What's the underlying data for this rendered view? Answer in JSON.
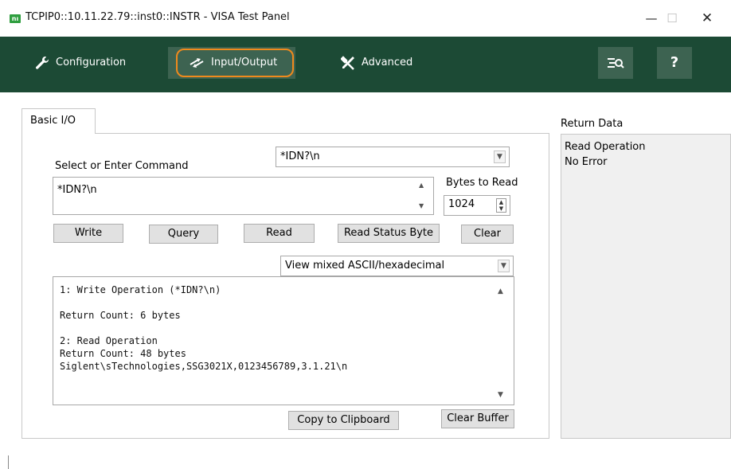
{
  "window": {
    "logo_text": "nı",
    "title": "TCPIP0::10.11.22.79::inst0::INSTR - VISA Test Panel",
    "minimize_glyph": "—",
    "maximize_glyph": "☐",
    "close_glyph": "✕"
  },
  "toolbar": {
    "configuration": "Configuration",
    "input_output": "Input/Output",
    "advanced": "Advanced",
    "help_glyph": "?",
    "accent_color": "#f08a1c",
    "bg_color": "#1c4a35",
    "active_bg_color": "#3d6351"
  },
  "tabs": [
    {
      "label": "Basic I/O",
      "selected": true
    }
  ],
  "basic_io": {
    "select_label": "Select or Enter Command",
    "command_combo_value": "*IDN?\\n",
    "command_text": "*IDN?\\n",
    "bytes_to_read_label": "Bytes to Read",
    "bytes_to_read_value": "1024",
    "buttons": {
      "write": "Write",
      "query": "Query",
      "read": "Read",
      "read_status_byte": "Read Status Byte",
      "clear": "Clear",
      "copy_to_clipboard": "Copy to Clipboard",
      "clear_buffer": "Clear Buffer"
    },
    "view_mode": "View mixed ASCII/hexadecimal",
    "output_text": "1: Write Operation (*IDN?\\n)\n\nReturn Count: 6 bytes\n\n2: Read Operation\nReturn Count: 48 bytes\nSiglent\\sTechnologies,SSG3021X,0123456789,3.1.21\\n"
  },
  "return_data": {
    "label": "Return Data",
    "lines": [
      "Read Operation",
      "No Error"
    ]
  },
  "icons": {
    "configuration": "wrench-icon",
    "input_output": "arrows-icon",
    "advanced": "tools-icon",
    "tool_button": "text-search-icon",
    "help": "help-icon"
  }
}
